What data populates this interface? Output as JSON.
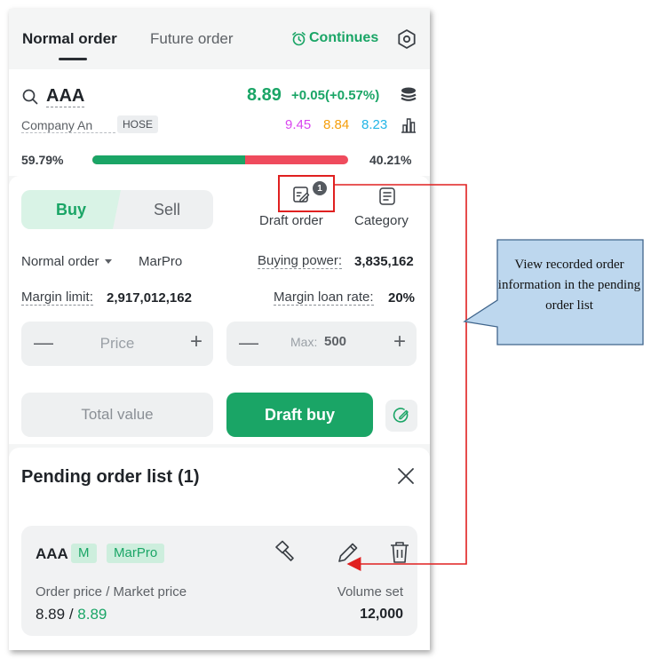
{
  "header": {
    "tabs": [
      {
        "label": "Normal order",
        "active": true
      },
      {
        "label": "Future order",
        "active": false
      }
    ],
    "continues_label": "Continues",
    "icons": {
      "continues": "alarm-clock-icon",
      "settings": "hexagon-settings-icon"
    }
  },
  "stock": {
    "ticker": "AAA",
    "price": "8.89",
    "change": "+0.05(+0.57%)",
    "company": "Company  An",
    "exchange": "HOSE",
    "ref_prices": [
      "9.45",
      "8.84",
      "8.23"
    ],
    "buy_ratio": "59.79%",
    "sell_ratio": "40.21%",
    "buy_ratio_value": 0.5979,
    "colors": {
      "up": "#1aa566",
      "down": "#ef4b5d",
      "ceiling": "#d946ef",
      "reference": "#f59e0b",
      "floor": "#22b5e6"
    }
  },
  "order_form": {
    "buy_label": "Buy",
    "sell_label": "Sell",
    "draft_order_label": "Draft order",
    "draft_badge_count": "1",
    "category_label": "Category",
    "order_type": "Normal order",
    "account_type": "MarPro",
    "buying_power_label": "Buying power",
    "buying_power_value": "3,835,162",
    "margin_limit_label": "Margin limit",
    "margin_limit_value": "2,917,012,162",
    "margin_loan_rate_label": "Margin loan rate",
    "margin_loan_rate_value": "20%",
    "price_placeholder": "Price",
    "volume_max_label": "Max:",
    "volume_max_value": "500",
    "total_value_label": "Total value",
    "draft_buy_label": "Draft buy"
  },
  "pending": {
    "title": "Pending order list",
    "count": "(1)",
    "orders": [
      {
        "ticker": "AAA",
        "tags": [
          "M",
          "MarPro"
        ],
        "order_price_label": "Order price / Market price",
        "order_price": "8.89",
        "market_price": "8.89",
        "volume_label": "Volume set",
        "volume": "12,000"
      }
    ]
  },
  "annotation": {
    "callout_text": "View recorded order information in the pending order list",
    "callout_color": "#bdd7ee",
    "arrow_color": "#e02020"
  }
}
